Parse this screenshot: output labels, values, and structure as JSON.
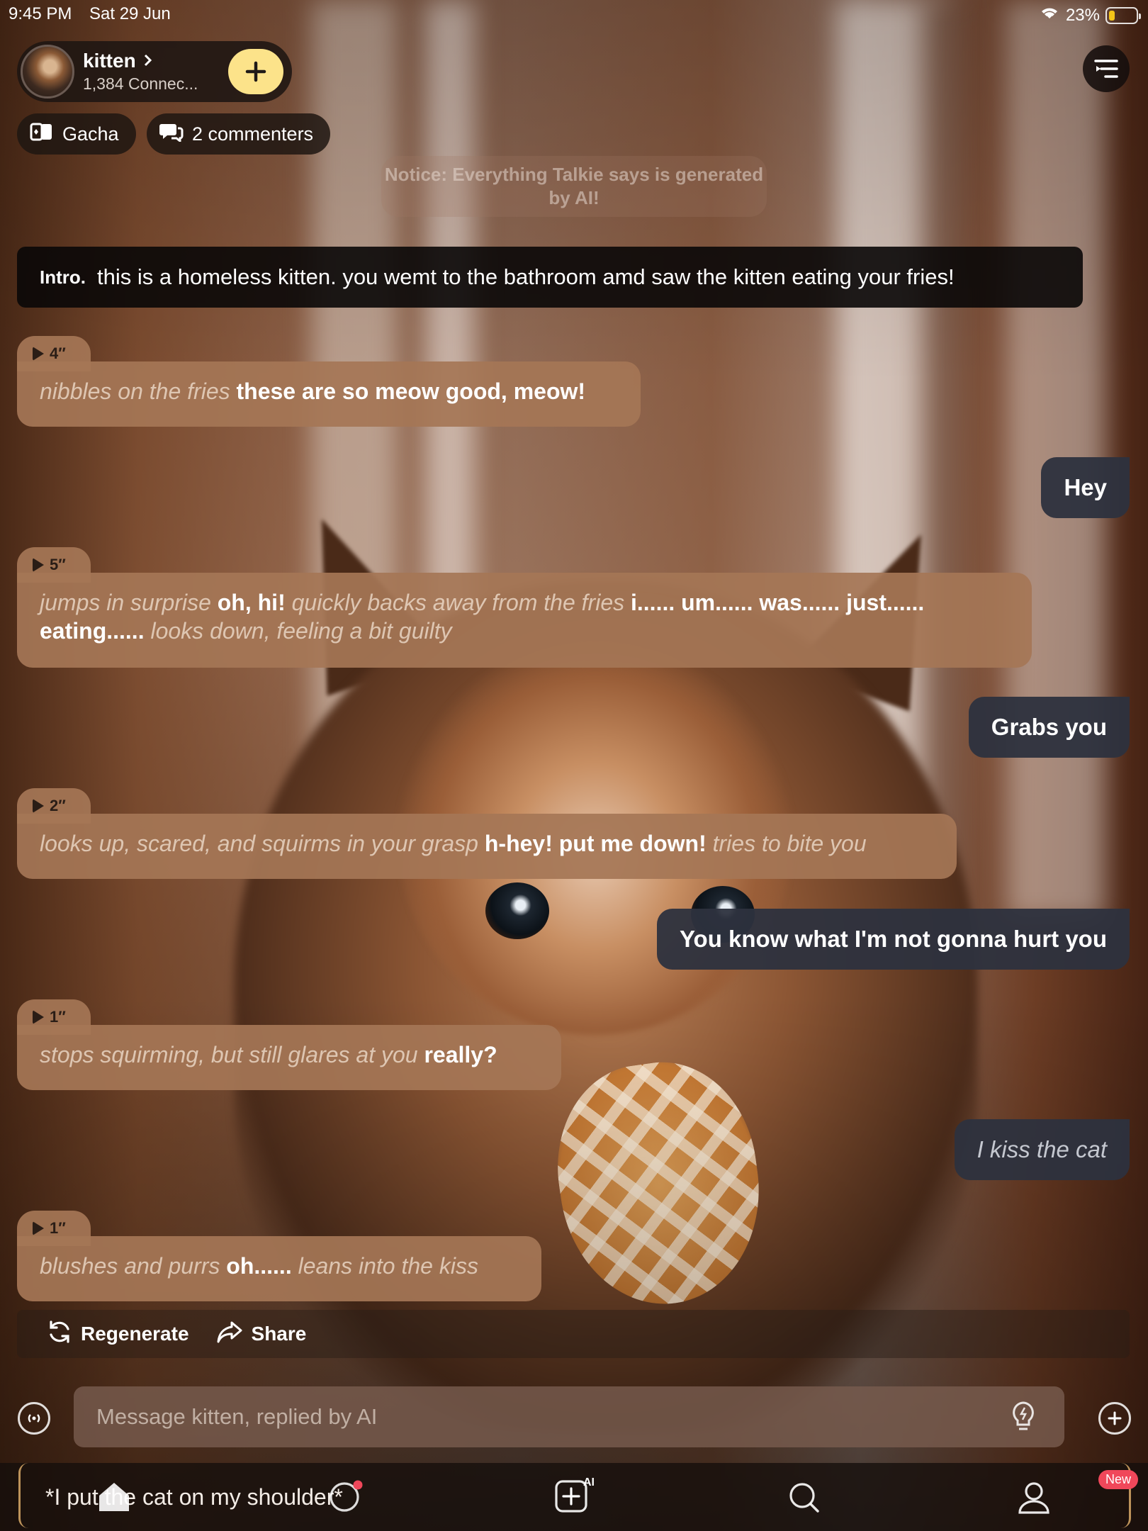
{
  "status_bar": {
    "time": "9:45 PM",
    "date": "Sat 29 Jun",
    "battery": "23%",
    "battery_level": 0.23
  },
  "header": {
    "character_name": "kitten",
    "connections": "1,384 Connec...",
    "gacha_label": "Gacha",
    "commenters_label": "2 commenters"
  },
  "notice": "Notice: Everything Talkie says is generated by AI!",
  "intro": {
    "tag": "Intro.",
    "text": "this is a homeless kitten. you wemt to the bathroom amd saw the kitten eating your fries!"
  },
  "messages": {
    "m1": {
      "duration": "4″",
      "a1": "nibbles on the fries ",
      "s1": "these are so meow good, meow!"
    },
    "u1": "Hey",
    "m2": {
      "duration": "5″",
      "a1": "jumps in surprise ",
      "s1": "oh, hi! ",
      "a2": "quickly backs away from the fries ",
      "s2": "i...... um...... was...... just...... eating...... ",
      "a3": "looks down, feeling a bit guilty"
    },
    "u2": "Grabs you",
    "m3": {
      "duration": "2″",
      "a1": "looks up, scared, and squirms in your grasp ",
      "s1": "h-hey! put me down! ",
      "a2": "tries to bite you"
    },
    "u3": "You know what I'm not gonna hurt you",
    "m4": {
      "duration": "1″",
      "a1": "stops squirming, but still glares at you ",
      "s1": "really?"
    },
    "u4": "I kiss the cat",
    "m5": {
      "duration": "1″",
      "a1": "blushes and purrs ",
      "s1": "oh...... ",
      "a2": "leans into the kiss"
    }
  },
  "actions": {
    "regenerate": "Regenerate",
    "share": "Share"
  },
  "composer": {
    "placeholder": "Message kitten, replied by AI"
  },
  "draft_text": "*I put the cat on my shoulder*",
  "tabbar": {
    "new_badge": "New",
    "create_ai_label": "AI"
  },
  "colors": {
    "accent": "#fce38a",
    "bot_bubble": "#a57656",
    "user_bubble": "#2d323e",
    "badge": "#f0475a"
  }
}
